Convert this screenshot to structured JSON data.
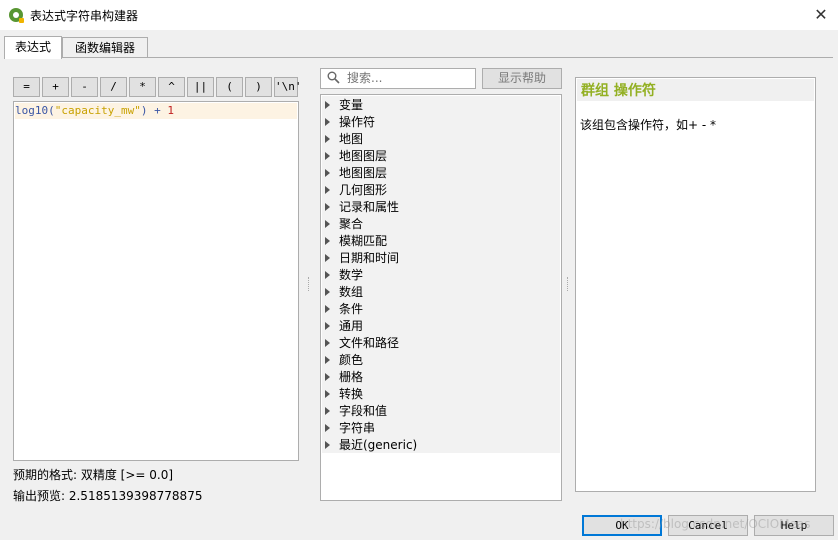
{
  "window": {
    "title": "表达式字符串构建器",
    "close_glyph": "✕"
  },
  "tabs": [
    {
      "label": "表达式"
    },
    {
      "label": "函数编辑器"
    }
  ],
  "operators": [
    "=",
    "+",
    "-",
    "/",
    "*",
    "^",
    "||",
    "(",
    ")",
    "'\\n'"
  ],
  "editor": {
    "fn": "log10",
    "open": "(",
    "field": "\"capacity_mw\"",
    "close": ")",
    "plus": "+",
    "num": "1"
  },
  "status": {
    "expected_format": "预期的格式: 双精度 [>= 0.0]",
    "output_preview": "输出预览: 2.5185139398778875"
  },
  "search": {
    "placeholder": "搜索..."
  },
  "show_help_label": "显示帮助",
  "groups": [
    "变量",
    "操作符",
    "地图",
    "地图图层",
    "地图图层",
    "几何图形",
    "记录和属性",
    "聚合",
    "模糊匹配",
    "日期和时间",
    "数学",
    "数组",
    "条件",
    "通用",
    "文件和路径",
    "颜色",
    "栅格",
    "转换",
    "字段和值",
    "字符串",
    "最近(generic)"
  ],
  "info": {
    "title": "群组 操作符",
    "text": "该组包含操作符，如+ - *"
  },
  "footer": {
    "ok": "OK",
    "cancel": "Cancel",
    "help": "Help"
  },
  "watermark": "https://blog.csdn.net/OCIOMeas",
  "colors": {
    "info_title": "#93b023",
    "accent": "#0078d7",
    "qgis_green": "#589632"
  }
}
